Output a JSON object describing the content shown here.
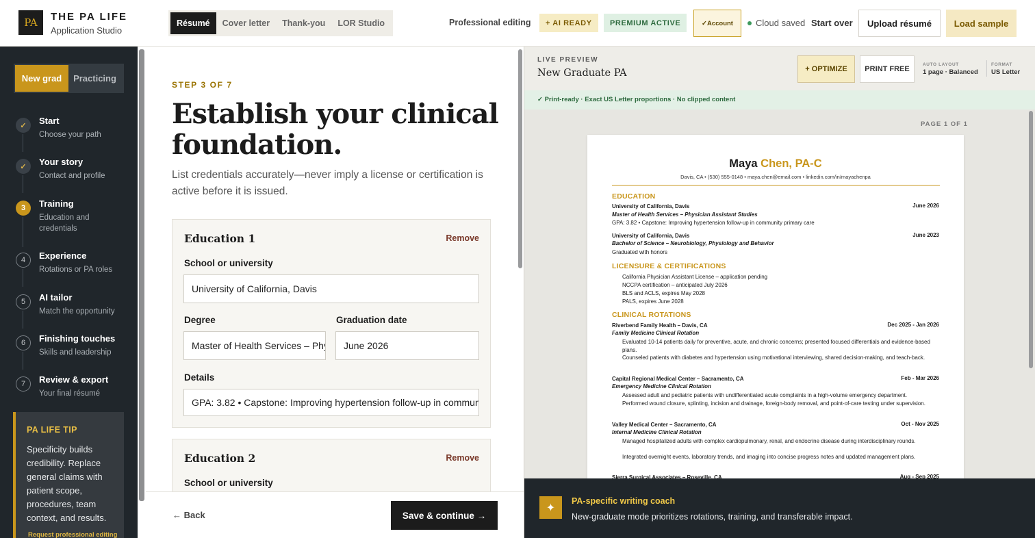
{
  "brand": {
    "logo": "PA",
    "title": "THE PA LIFE",
    "subtitle": "Application Studio"
  },
  "doc_tabs": [
    {
      "label": "Résumé",
      "active": true
    },
    {
      "label": "Cover letter",
      "active": false
    },
    {
      "label": "Thank-you",
      "active": false
    },
    {
      "label": "LOR Studio",
      "active": false
    }
  ],
  "header": {
    "professional_editing": "Professional editing",
    "ai_badge": "+ AI READY",
    "premium_badge": "PREMIUM ACTIVE",
    "account": "✓Account",
    "cloud_status": "Cloud saved",
    "start_over": "Start over",
    "upload": "Upload résumé",
    "load_sample": "Load sample"
  },
  "sidebar": {
    "paths": [
      {
        "label": "New grad",
        "active": true
      },
      {
        "label": "Practicing",
        "active": false
      }
    ],
    "steps": [
      {
        "marker": "✓",
        "state": "done",
        "title": "Start",
        "sub": "Choose your path"
      },
      {
        "marker": "✓",
        "state": "done",
        "title": "Your story",
        "sub": "Contact and profile"
      },
      {
        "marker": "3",
        "state": "current",
        "title": "Training",
        "sub": "Education and credentials"
      },
      {
        "marker": "4",
        "state": "todo",
        "title": "Experience",
        "sub": "Rotations or PA roles"
      },
      {
        "marker": "5",
        "state": "todo",
        "title": "AI tailor",
        "sub": "Match the opportunity"
      },
      {
        "marker": "6",
        "state": "todo",
        "title": "Finishing touches",
        "sub": "Skills and leadership"
      },
      {
        "marker": "7",
        "state": "todo",
        "title": "Review & export",
        "sub": "Your final résumé"
      }
    ],
    "tip": {
      "title": "PA LIFE TIP",
      "text": "Specificity builds credibility. Replace general claims with patient scope, procedures, team context, and results.",
      "link": "Request professional editing"
    }
  },
  "form": {
    "step_label": "STEP 3 OF 7",
    "title": "Establish your clinical foundation.",
    "description": "List credentials accurately—never imply a license or certification is active before it is issued.",
    "education": [
      {
        "heading": "Education 1",
        "remove": "Remove",
        "school_label": "School or university",
        "school": "University of California, Davis",
        "degree_label": "Degree",
        "degree": "Master of Health Services – Physician Assistant Studies",
        "grad_label": "Graduation date",
        "grad": "June 2026",
        "details_label": "Details",
        "details": "GPA: 3.82  •  Capstone: Improving hypertension follow-up in community primary care"
      },
      {
        "heading": "Education 2",
        "remove": "Remove",
        "school_label": "School or university"
      }
    ],
    "back": "← Back",
    "save": "Save & continue →"
  },
  "preview": {
    "kicker": "LIVE PREVIEW",
    "title": "New Graduate PA",
    "optimize": "+ OPTIMIZE",
    "print": "PRINT FREE",
    "auto_layout_key": "AUTO LAYOUT",
    "auto_layout_val": "1 page · Balanced",
    "format_key": "FORMAT",
    "format_val": "US Letter",
    "status": "✓ Print-ready · Exact US Letter proportions · No clipped content",
    "page_count": "PAGE 1 OF 1",
    "coach_title": "PA-specific writing coach",
    "coach_text": "New-graduate mode prioritizes rotations, training, and transferable impact."
  },
  "resume": {
    "name_first": "Maya",
    "name_last": "Chen, PA-C",
    "contact": "Davis, CA • (530) 555-0148 • maya.chen@email.com • linkedin.com/in/mayachenpa",
    "education_heading": "EDUCATION",
    "edu1_school": "University of California, Davis",
    "edu1_date": "June 2026",
    "edu1_degree": "Master of Health Services – Physician Assistant Studies",
    "edu1_detail": "GPA: 3.82 • Capstone: Improving hypertension follow-up in community primary care",
    "edu2_school": "University of California, Davis",
    "edu2_date": "June 2023",
    "edu2_degree": "Bachelor of Science – Neurobiology, Physiology and Behavior",
    "edu2_detail": "Graduated with honors",
    "lic_heading": "LICENSURE & CERTIFICATIONS",
    "lic": [
      "California Physician Assistant License – application pending",
      "NCCPA certification – anticipated July 2026",
      "BLS and ACLS, expires May 2028",
      "PALS, expires June 2028"
    ],
    "rot_heading": "CLINICAL ROTATIONS",
    "rot1_site": "Riverbend Family Health – Davis, CA",
    "rot1_date": "Dec 2025 - Jan 2026",
    "rot1_title": "Family Medicine Clinical Rotation",
    "rot1_b1": "Evaluated 10-14 patients daily for preventive, acute, and chronic concerns; presented focused differentials and evidence-based plans.",
    "rot1_b2": "Counseled patients with diabetes and hypertension using motivational interviewing, shared decision-making, and teach-back.",
    "rot2_site": "Capital Regional Medical Center – Sacramento, CA",
    "rot2_date": "Feb - Mar 2026",
    "rot2_title": "Emergency Medicine Clinical Rotation",
    "rot2_b1": "Assessed adult and pediatric patients with undifferentiated acute complaints in a high-volume emergency department.",
    "rot2_b2": "Performed wound closure, splinting, incision and drainage, foreign-body removal, and point-of-care testing under supervision.",
    "rot3_site": "Valley Medical Center – Sacramento, CA",
    "rot3_date": "Oct - Nov 2025",
    "rot3_title": "Internal Medicine Clinical Rotation",
    "rot3_b1": "Managed hospitalized adults with complex cardiopulmonary, renal, and endocrine disease during interdisciplinary rounds.",
    "rot3_b2": "Integrated overnight events, laboratory trends, and imaging into concise progress notes and updated management plans.",
    "rot4_site": "Sierra Surgical Associates – Roseville, CA",
    "rot4_date": "Aug - Sep 2025"
  },
  "colors": {
    "gold": "#c9961c",
    "dark": "#20262b",
    "green": "#2d6a3e"
  }
}
